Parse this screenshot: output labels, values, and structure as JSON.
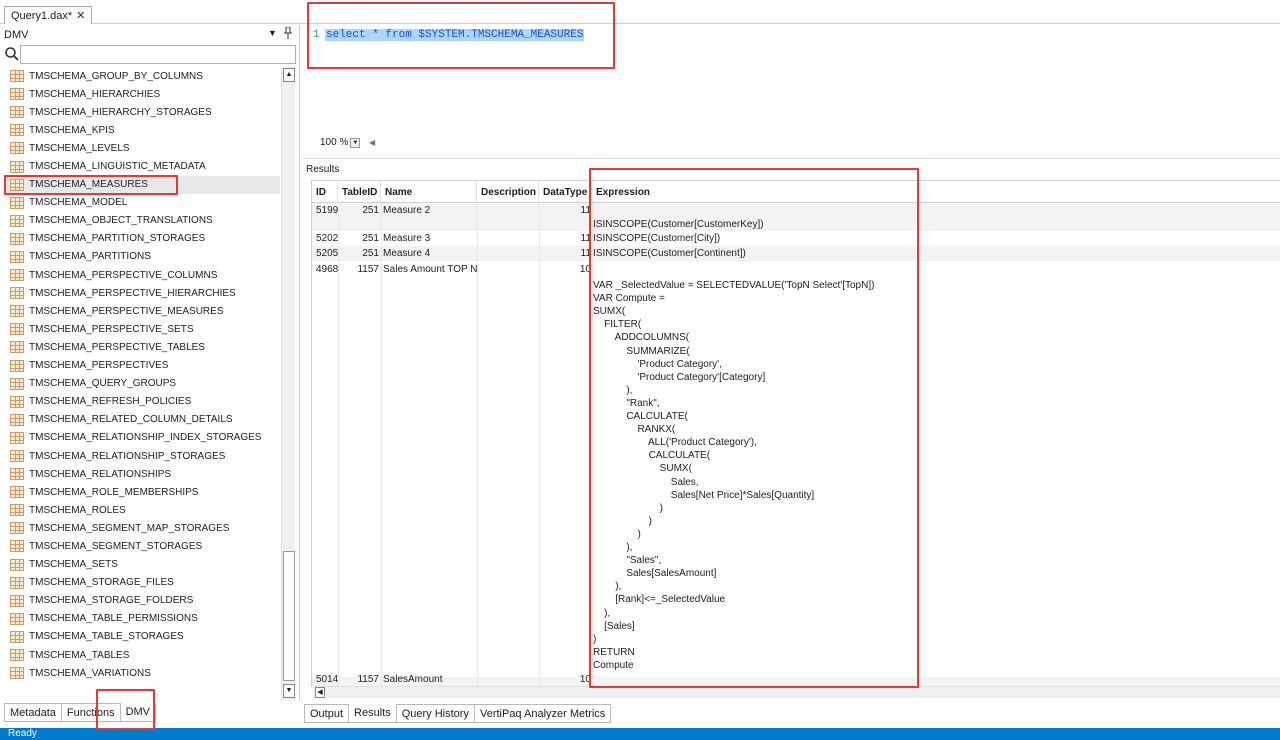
{
  "document_tab": {
    "label": "Query1.dax*",
    "close": "✕"
  },
  "left_panel": {
    "title": "DMV",
    "dropdown_glyph": "▼",
    "pin_glyph": "ᛜ",
    "search_placeholder": "",
    "items": [
      "TMSCHEMA_GROUP_BY_COLUMNS",
      "TMSCHEMA_HIERARCHIES",
      "TMSCHEMA_HIERARCHY_STORAGES",
      "TMSCHEMA_KPIS",
      "TMSCHEMA_LEVELS",
      "TMSCHEMA_LINGUISTIC_METADATA",
      "TMSCHEMA_MEASURES",
      "TMSCHEMA_MODEL",
      "TMSCHEMA_OBJECT_TRANSLATIONS",
      "TMSCHEMA_PARTITION_STORAGES",
      "TMSCHEMA_PARTITIONS",
      "TMSCHEMA_PERSPECTIVE_COLUMNS",
      "TMSCHEMA_PERSPECTIVE_HIERARCHIES",
      "TMSCHEMA_PERSPECTIVE_MEASURES",
      "TMSCHEMA_PERSPECTIVE_SETS",
      "TMSCHEMA_PERSPECTIVE_TABLES",
      "TMSCHEMA_PERSPECTIVES",
      "TMSCHEMA_QUERY_GROUPS",
      "TMSCHEMA_REFRESH_POLICIES",
      "TMSCHEMA_RELATED_COLUMN_DETAILS",
      "TMSCHEMA_RELATIONSHIP_INDEX_STORAGES",
      "TMSCHEMA_RELATIONSHIP_STORAGES",
      "TMSCHEMA_RELATIONSHIPS",
      "TMSCHEMA_ROLE_MEMBERSHIPS",
      "TMSCHEMA_ROLES",
      "TMSCHEMA_SEGMENT_MAP_STORAGES",
      "TMSCHEMA_SEGMENT_STORAGES",
      "TMSCHEMA_SETS",
      "TMSCHEMA_STORAGE_FILES",
      "TMSCHEMA_STORAGE_FOLDERS",
      "TMSCHEMA_TABLE_PERMISSIONS",
      "TMSCHEMA_TABLE_STORAGES",
      "TMSCHEMA_TABLES",
      "TMSCHEMA_VARIATIONS"
    ],
    "selected_item": "TMSCHEMA_MEASURES",
    "tabs": [
      "Metadata",
      "Functions",
      "DMV"
    ],
    "active_tab": "DMV"
  },
  "editor": {
    "line_number": "1",
    "code": "select * from $SYSTEM.TMSCHEMA_MEASURES",
    "zoom": "100 %"
  },
  "results": {
    "label": "Results",
    "columns": [
      "ID",
      "TableID",
      "Name",
      "Description",
      "DataType",
      "Expression"
    ],
    "rows": [
      {
        "id": "5199",
        "table_id": "251",
        "name": "Measure 2",
        "description": "",
        "data_type": "11",
        "expression_first": "ISINSCOPE(Customer[CustomerKey])"
      },
      {
        "id": "5202",
        "table_id": "251",
        "name": "Measure 3",
        "description": "",
        "data_type": "11",
        "expression_first": "ISINSCOPE(Customer[City])"
      },
      {
        "id": "5205",
        "table_id": "251",
        "name": "Measure 4",
        "description": "",
        "data_type": "11",
        "expression_first": "ISINSCOPE(Customer[Continent])"
      },
      {
        "id": "4968",
        "table_id": "1157",
        "name": "Sales Amount TOP N",
        "description": "",
        "data_type": "10",
        "expression_first": ""
      },
      {
        "id": "5014",
        "table_id": "1157",
        "name": "SalesAmount",
        "description": "",
        "data_type": "10",
        "expression_first": ""
      }
    ],
    "expression_lines": [
      "VAR _SelectedValue = SELECTEDVALUE('TopN Select'[TopN])",
      "VAR Compute =",
      "SUMX(",
      "    FILTER(",
      "        ADDCOLUMNS(",
      "            SUMMARIZE(",
      "                'Product Category',",
      "                'Product Category'[Category]",
      "            ),",
      "            \"Rank\",",
      "            CALCULATE(",
      "                RANKX(",
      "                    ALL('Product Category'),",
      "                    CALCULATE(",
      "                        SUMX(",
      "                            Sales,",
      "                            Sales[Net Price]*Sales[Quantity]",
      "                        )",
      "                    )",
      "                )",
      "            ),",
      "            \"Sales\",",
      "            Sales[SalesAmount]",
      "        ),",
      "        [Rank]<=_SelectedValue",
      "    ),",
      "    [Sales]",
      ")",
      "RETURN",
      "Compute"
    ]
  },
  "results_tabs": [
    "Output",
    "Results",
    "Query History",
    "VertiPaq Analyzer Metrics"
  ],
  "active_results_tab": "Results",
  "status": {
    "text": "Ready"
  },
  "colors": {
    "status_bar": "#007acc",
    "highlight": "#e3393a",
    "selection": "#add6ff"
  }
}
